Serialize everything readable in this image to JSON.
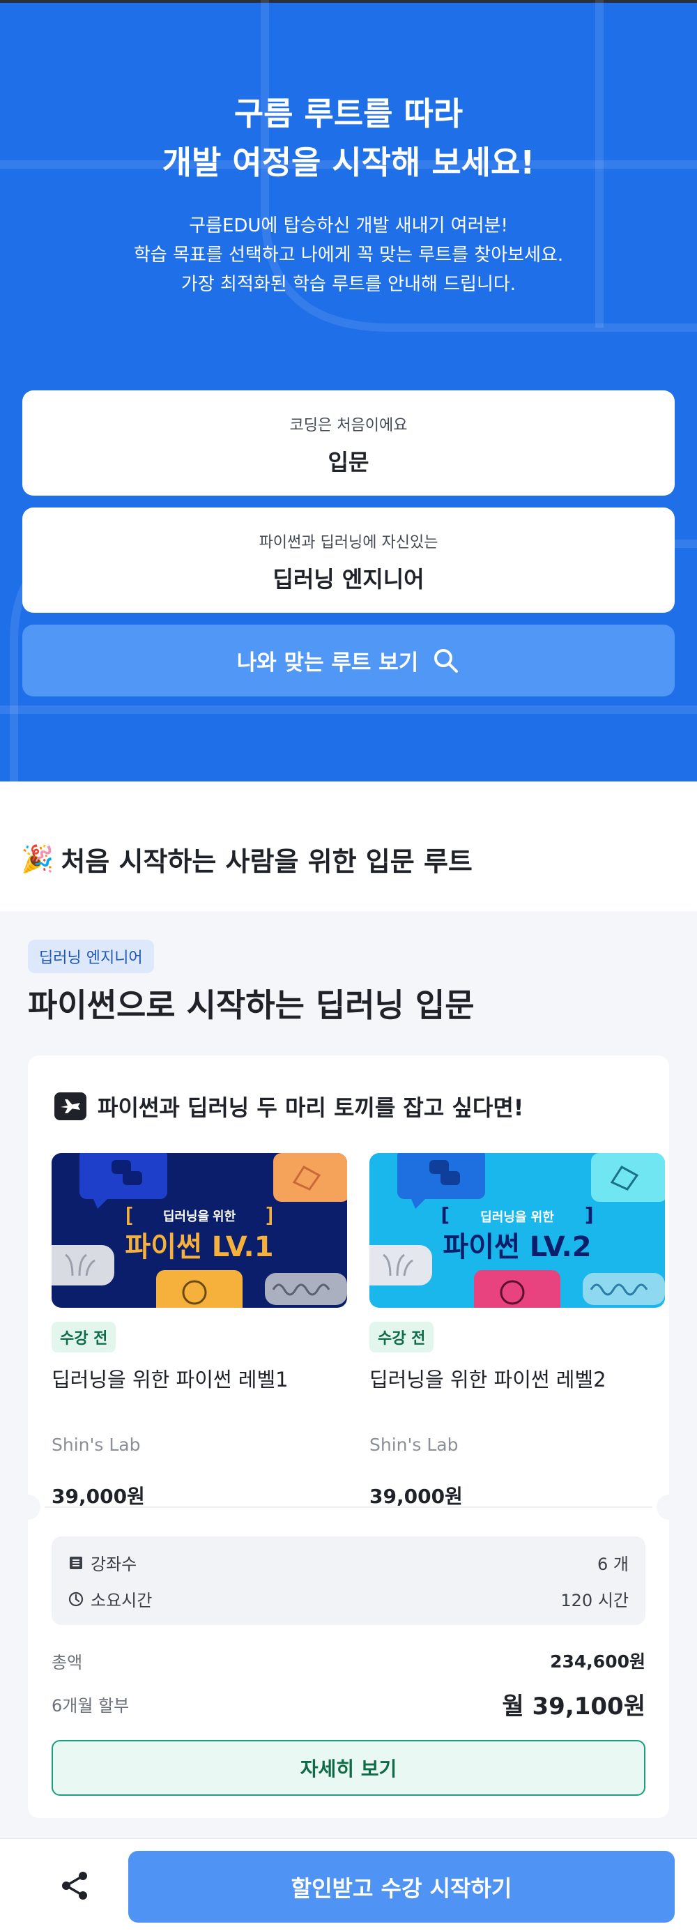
{
  "hero": {
    "title_line1": "구름 루트를 따라",
    "title_line2": "개발 여정을 시작해 보세요!",
    "desc_line1": "구름EDU에 탑승하신 개발 새내기 여러분!",
    "desc_line2": "학습 목표를 선택하고 나에게 꼭 맞는 루트를 찾아보세요.",
    "desc_line3": "가장 최적화된 학습 루트를 안내해 드립니다.",
    "level_select": {
      "caption": "코딩은 처음이에요",
      "value": "입문"
    },
    "goal_select": {
      "caption": "파이썬과 딥러닝에 자신있는",
      "value": "딥러닝 엔지니어"
    },
    "search_button_label": "나와 맞는 루트 보기",
    "background_color": "#1f6fe8"
  },
  "section": {
    "emoji": "🎉",
    "title": "처음 시작하는 사람을 위한 입문 루트"
  },
  "route": {
    "tag": "딥러닝 엔지니어",
    "title": "파이썬으로 시작하는 딥러닝 입문",
    "subtitle": "파이썬과 딥러닝 두 마리 토끼를 잡고 싶다면!",
    "courses": [
      {
        "thumb_small": "딥러닝을 위한",
        "thumb_big": "파이썬 LV.1",
        "thumb_bg": "#0b1e6b",
        "status": "수강 전",
        "name": "딥러닝을 위한 파이썬 레벨1",
        "provider": "Shin's Lab",
        "price": "39,000원"
      },
      {
        "thumb_small": "딥러닝을 위한",
        "thumb_big": "파이썬 LV.2",
        "thumb_bg": "#19b7ec",
        "status": "수강 전",
        "name": "딥러닝을 위한 파이썬 레벨2",
        "provider": "Shin's Lab",
        "price": "39,000원"
      }
    ],
    "info": {
      "lectures_label": "강좌수",
      "lectures_value": "6 개",
      "time_label": "소요시간",
      "time_value": "120 시간"
    },
    "total_label": "총액",
    "total_value": "234,600원",
    "installment_label": "6개월 할부",
    "installment_value": "월 39,100원",
    "detail_button_label": "자세히 보기"
  },
  "bottom_bar": {
    "cta_label": "할인받고 수강 시작하기",
    "accent": "#4f93f5"
  }
}
